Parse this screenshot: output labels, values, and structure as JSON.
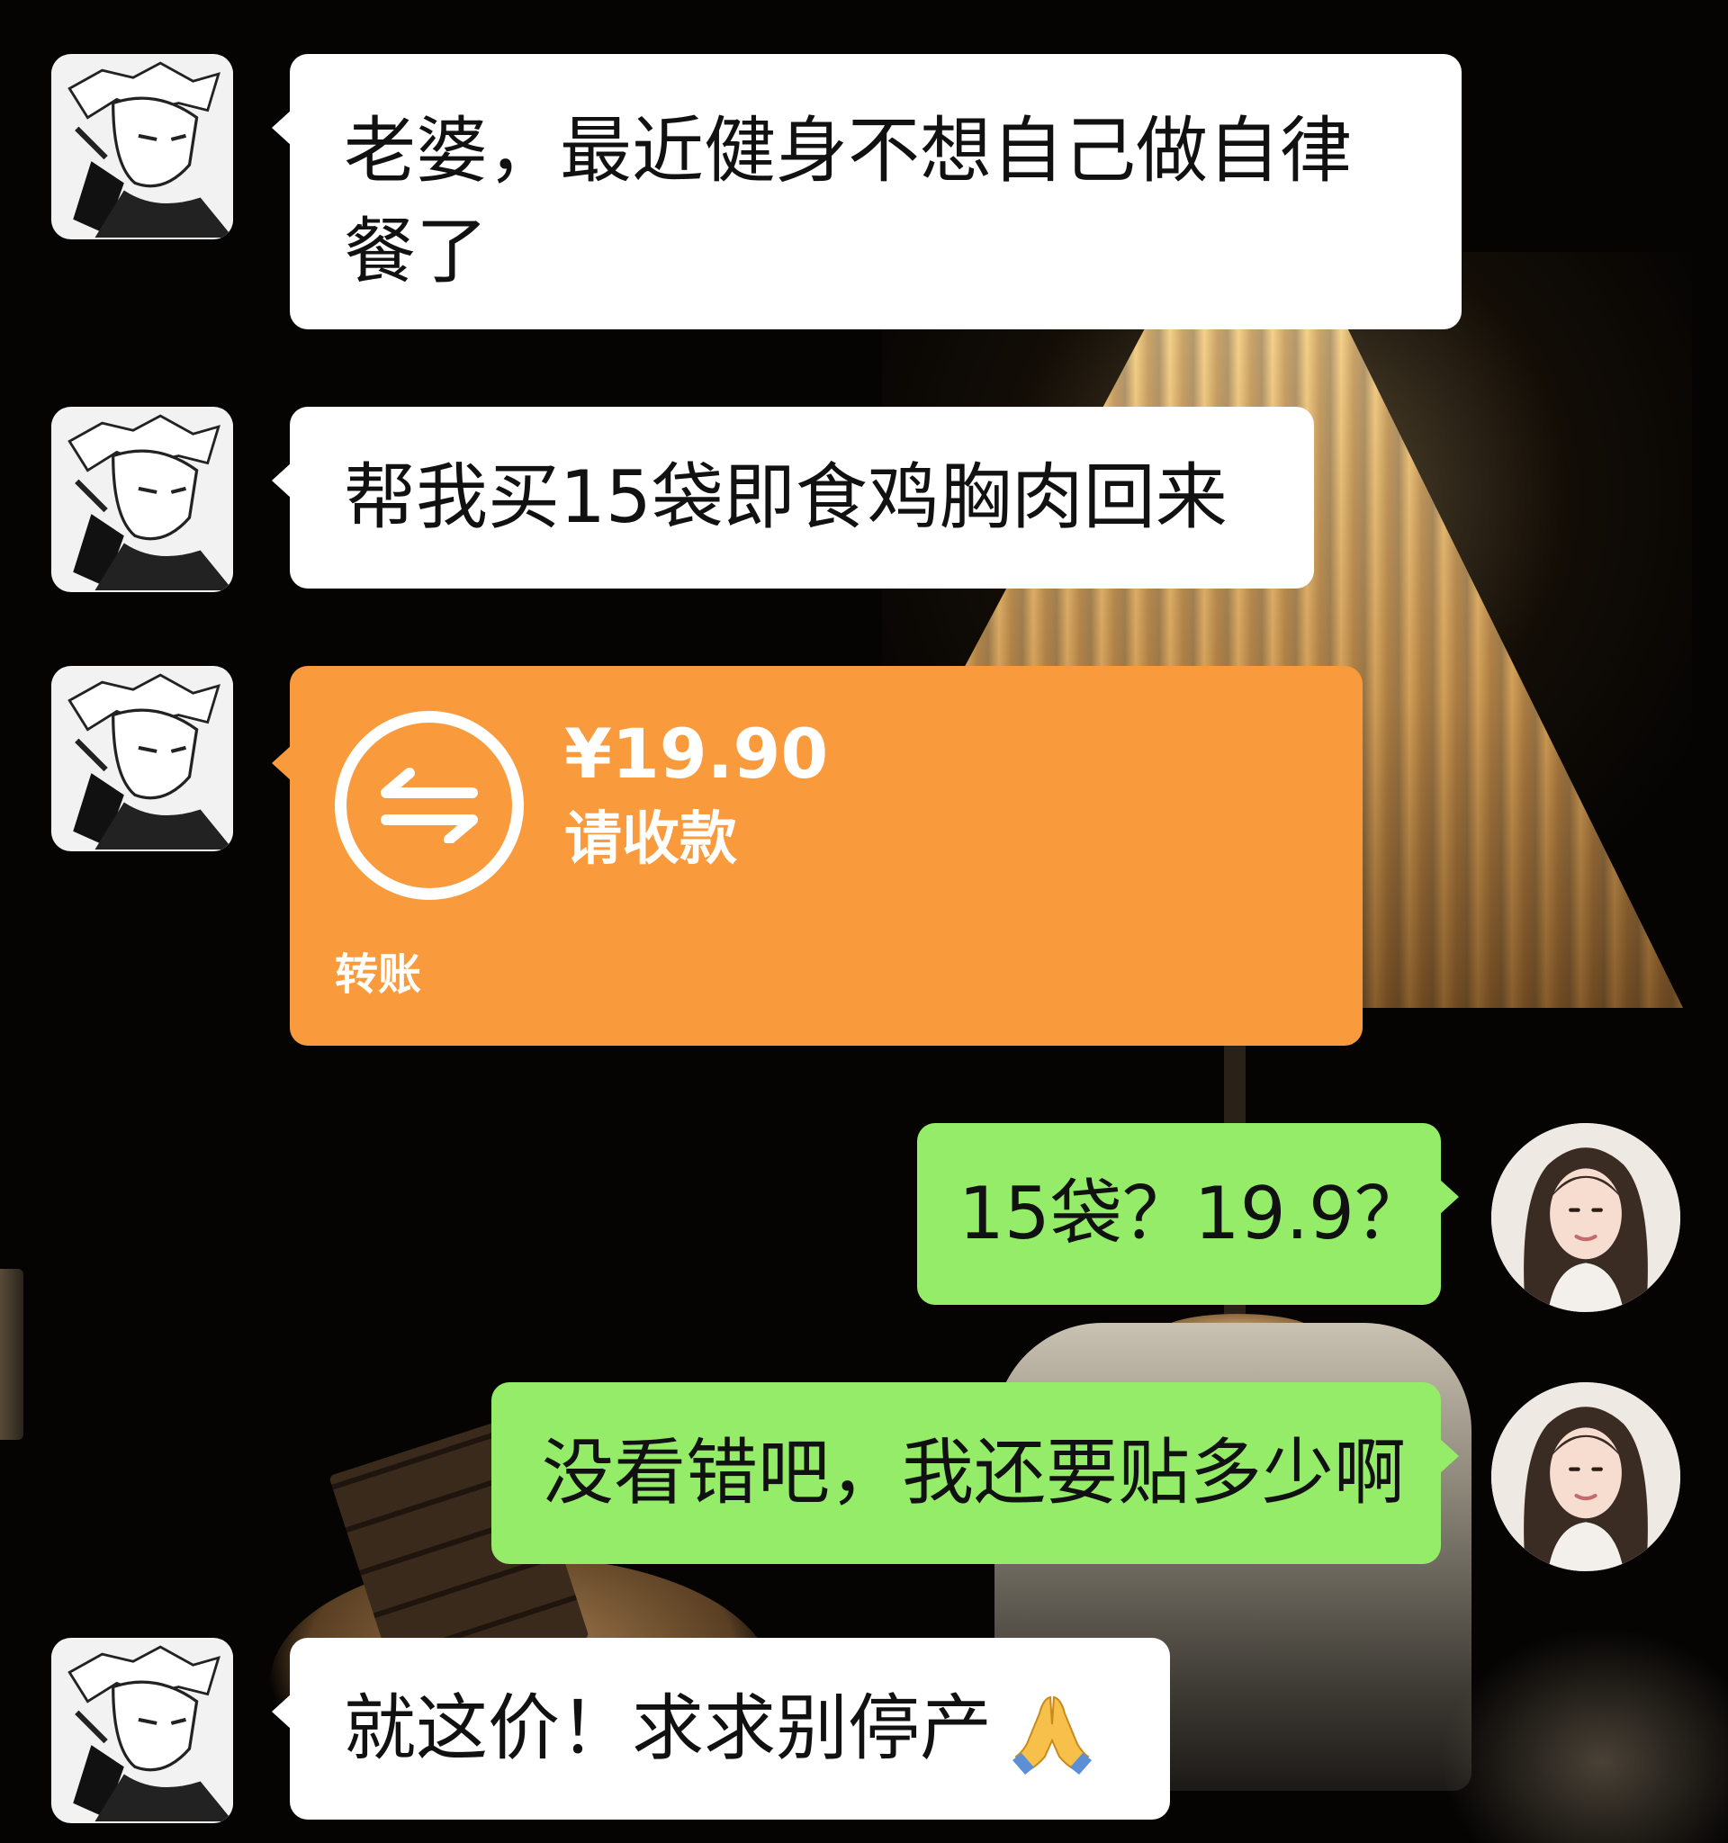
{
  "messages": [
    {
      "sender": "left",
      "text": "老婆，最近健身不想自己做自律餐了"
    },
    {
      "sender": "left",
      "text": "帮我买15袋即食鸡胸肉回来"
    },
    {
      "sender": "left",
      "type": "transfer",
      "amount": "¥19.90",
      "status": "请收款",
      "label": "转账"
    },
    {
      "sender": "right",
      "text": "15袋？19.9？"
    },
    {
      "sender": "right",
      "text": "没看错吧，我还要贴多少啊"
    },
    {
      "sender": "left",
      "text": "就这价！求求别停产",
      "emoji": "folded-hands"
    }
  ],
  "colors": {
    "incoming_bubble": "#ffffff",
    "outgoing_bubble": "#95ec69",
    "transfer_card": "#f99b3c",
    "background": "#050403"
  },
  "icons": {
    "transfer": "transfer-arrows-icon",
    "emoji": "folded-hands-emoji-icon"
  }
}
